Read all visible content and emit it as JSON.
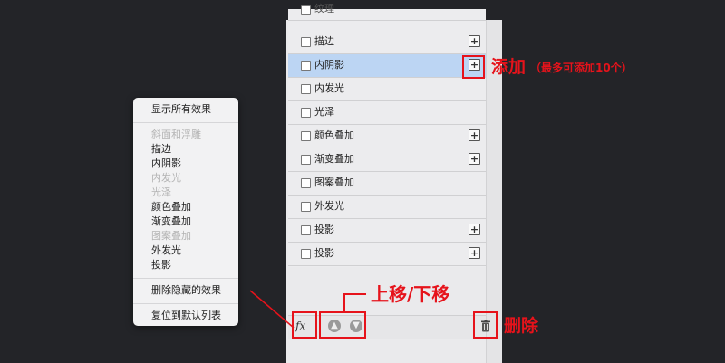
{
  "menu": {
    "show_all": "显示所有效果",
    "effects": [
      {
        "label": "斜面和浮雕",
        "disabled": true
      },
      {
        "label": "描边",
        "disabled": false
      },
      {
        "label": "内阴影",
        "disabled": false
      },
      {
        "label": "内发光",
        "disabled": true
      },
      {
        "label": "光泽",
        "disabled": true
      },
      {
        "label": "颜色叠加",
        "disabled": false
      },
      {
        "label": "渐变叠加",
        "disabled": false
      },
      {
        "label": "图案叠加",
        "disabled": true
      },
      {
        "label": "外发光",
        "disabled": false
      },
      {
        "label": "投影",
        "disabled": false
      }
    ],
    "delete_hidden": "删除隐藏的效果",
    "reset_default": "复位到默认列表"
  },
  "panel": {
    "cut_item": "纹理",
    "items": [
      {
        "label": "描边",
        "plus": true,
        "selected": false
      },
      {
        "label": "内阴影",
        "plus": true,
        "selected": true
      },
      {
        "label": "内发光",
        "plus": false,
        "selected": false
      },
      {
        "label": "光泽",
        "plus": false,
        "selected": false
      },
      {
        "label": "颜色叠加",
        "plus": true,
        "selected": false
      },
      {
        "label": "渐变叠加",
        "plus": true,
        "selected": false
      },
      {
        "label": "图案叠加",
        "plus": false,
        "selected": false
      },
      {
        "label": "外发光",
        "plus": false,
        "selected": false
      },
      {
        "label": "投影",
        "plus": true,
        "selected": false
      },
      {
        "label": "投影",
        "plus": true,
        "selected": false
      }
    ],
    "plus_symbol": "+",
    "fx_label": "fx",
    "move_up_symbol": "▲",
    "move_down_symbol": "▼"
  },
  "annotations": {
    "add": "添加",
    "add_note": "（最多可添加10个）",
    "move": "上移/下移",
    "delete": "删除"
  },
  "colors": {
    "annotation_red": "#e6131b",
    "selected_row": "#bcd5f3",
    "background": "#232428"
  }
}
